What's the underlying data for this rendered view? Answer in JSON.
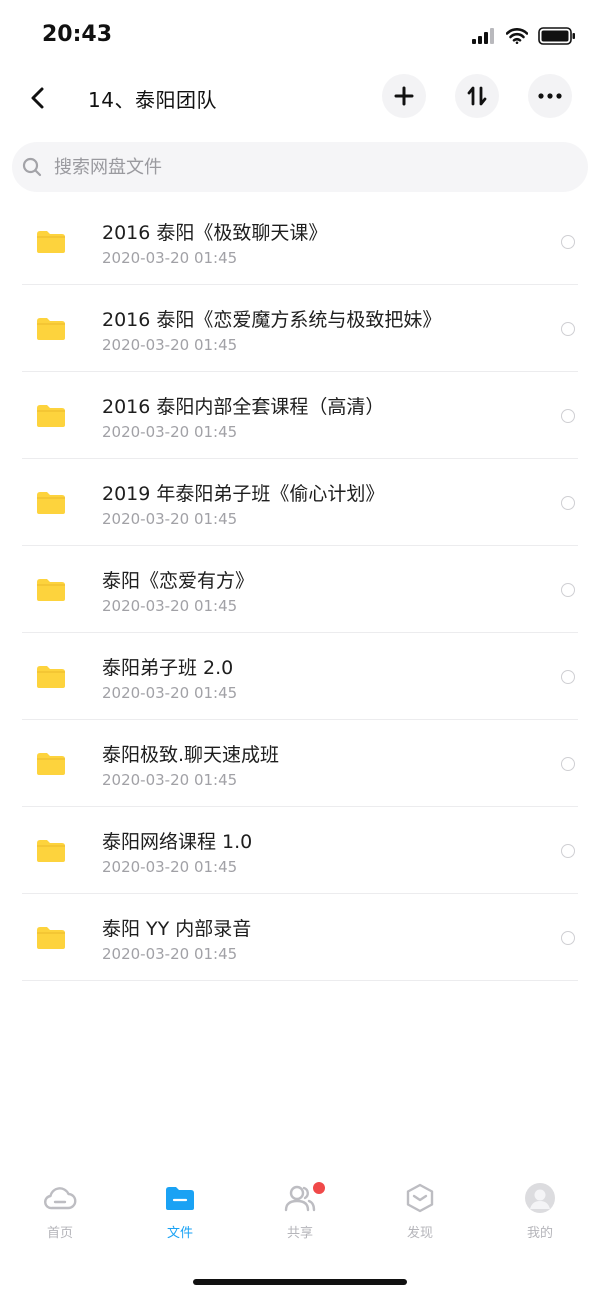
{
  "status_bar": {
    "time": "20:43"
  },
  "header": {
    "title": "14、泰阳团队"
  },
  "search": {
    "placeholder": "搜索网盘文件"
  },
  "files": [
    {
      "name": "2016 泰阳《极致聊天课》",
      "date": "2020-03-20 01:45"
    },
    {
      "name": "2016 泰阳《恋爱魔方系统与极致把妹》",
      "date": "2020-03-20 01:45"
    },
    {
      "name": "2016 泰阳内部全套课程（高清）",
      "date": "2020-03-20 01:45"
    },
    {
      "name": "2019 年泰阳弟子班《偷心计划》",
      "date": "2020-03-20 01:45"
    },
    {
      "name": "泰阳《恋爱有方》",
      "date": "2020-03-20 01:45"
    },
    {
      "name": "泰阳弟子班 2.0",
      "date": "2020-03-20 01:45"
    },
    {
      "name": "泰阳极致.聊天速成班",
      "date": "2020-03-20 01:45"
    },
    {
      "name": "泰阳网络课程 1.0",
      "date": "2020-03-20 01:45"
    },
    {
      "name": "泰阳 YY 内部录音",
      "date": "2020-03-20 01:45"
    }
  ],
  "tabs": [
    {
      "label": "首页",
      "icon": "cloud-icon"
    },
    {
      "label": "文件",
      "icon": "folder-icon",
      "active": true
    },
    {
      "label": "共享",
      "icon": "people-icon",
      "badge": true
    },
    {
      "label": "发现",
      "icon": "discover-icon"
    },
    {
      "label": "我的",
      "icon": "avatar-icon"
    }
  ],
  "colors": {
    "accent": "#1aa2f4",
    "folder": "#fdd33d",
    "badge": "#f04949"
  }
}
